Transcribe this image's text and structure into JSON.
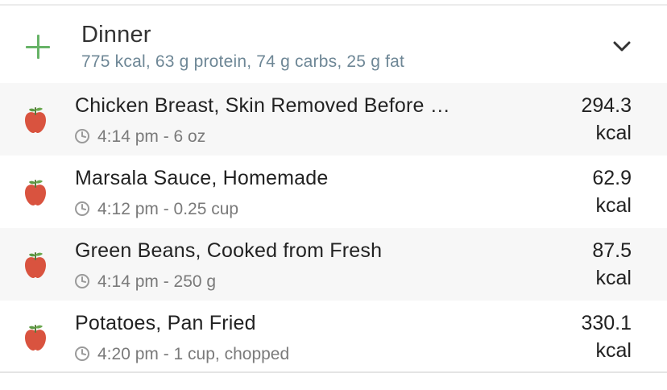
{
  "meal": {
    "title": "Dinner",
    "summary": "775 kcal, 63 g protein, 74 g carbs, 25 g fat",
    "add_icon": "plus-icon",
    "collapse_icon": "chevron-down-icon",
    "accent_color": "#67b367"
  },
  "items": [
    {
      "name": "Chicken Breast, Skin Removed Before …",
      "meta": "4:14 pm - 6 oz",
      "kcal": "294.3",
      "unit": "kcal",
      "icon": "apple-icon"
    },
    {
      "name": "Marsala Sauce, Homemade",
      "meta": "4:12 pm - 0.25 cup",
      "kcal": "62.9",
      "unit": "kcal",
      "icon": "apple-icon"
    },
    {
      "name": "Green Beans, Cooked from Fresh",
      "meta": "4:14 pm - 250 g",
      "kcal": "87.5",
      "unit": "kcal",
      "icon": "apple-icon"
    },
    {
      "name": "Potatoes, Pan Fried",
      "meta": "4:20 pm - 1 cup, chopped",
      "kcal": "330.1",
      "unit": "kcal",
      "icon": "apple-icon"
    }
  ]
}
